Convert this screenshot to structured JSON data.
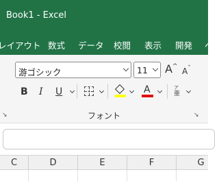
{
  "titlebar": {
    "title": "Book1  -  Excel"
  },
  "tabs": [
    {
      "label": "レイアウト"
    },
    {
      "label": "数式"
    },
    {
      "label": "データ"
    },
    {
      "label": "校閲"
    },
    {
      "label": "表示"
    },
    {
      "label": "開発"
    },
    {
      "label": "ヘ"
    }
  ],
  "font": {
    "name": "游ゴシック",
    "size": "11",
    "grow_label": "A",
    "shrink_label": "A",
    "group_label": "フォント",
    "bold": "B",
    "italic": "I",
    "underline": "U",
    "font_color_label": "A",
    "phonetic_label": "亜",
    "fill_color": "#ffff00",
    "font_color": "#e01010"
  },
  "columns": [
    "C",
    "D",
    "E",
    "F",
    "G"
  ]
}
